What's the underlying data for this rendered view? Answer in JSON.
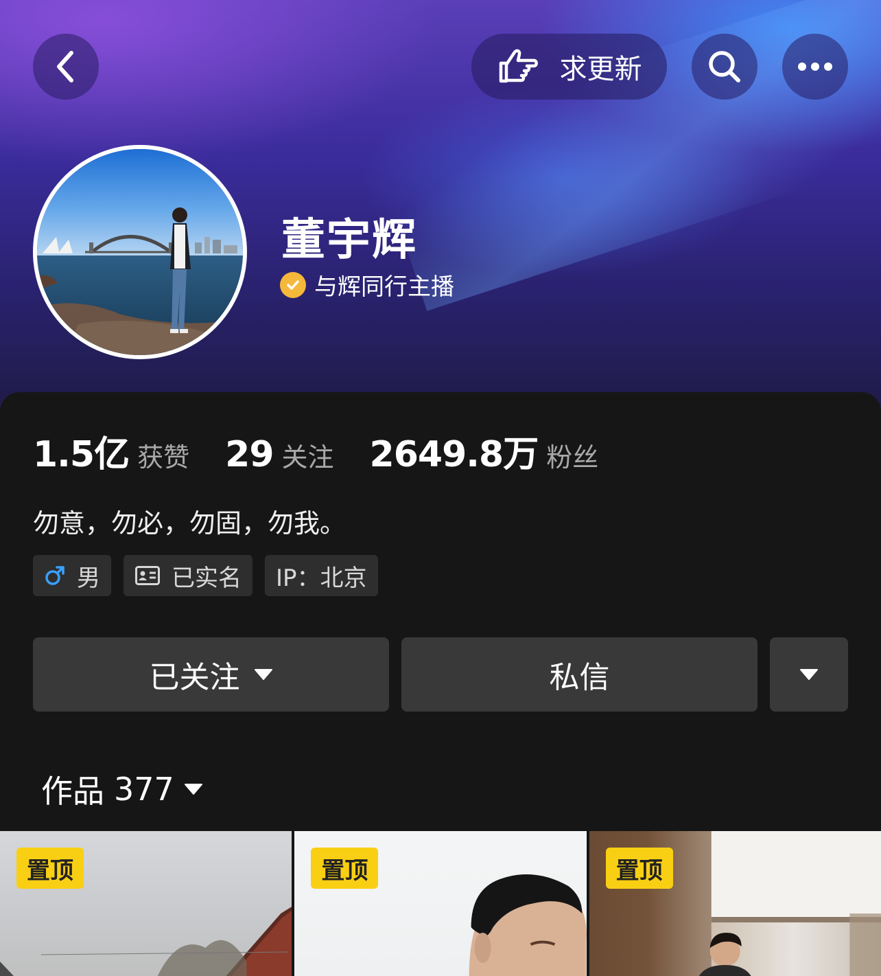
{
  "header": {
    "update_label": "求更新"
  },
  "profile": {
    "name": "董宇辉",
    "verified_label": "与辉同行主播"
  },
  "stats": {
    "likes_value": "1.5亿",
    "likes_label": "获赞",
    "following_value": "29",
    "following_label": "关注",
    "followers_value": "2649.8万",
    "followers_label": "粉丝"
  },
  "bio": "勿意，勿必，勿固，勿我。",
  "tags": {
    "gender": "男",
    "realname": "已实名",
    "ip": "IP：北京"
  },
  "actions": {
    "follow_label": "已关注",
    "message_label": "私信"
  },
  "works": {
    "label": "作品",
    "count": "377"
  },
  "grid": {
    "pin_label": "置顶"
  },
  "colors": {
    "verify_badge": "#f6b83a",
    "pin_badge": "#f9cf14",
    "gender_icon": "#3aa0ff",
    "background": "#161616",
    "button": "#393939"
  },
  "icons": [
    "back-arrow-icon",
    "pointing-hand-icon",
    "search-icon",
    "more-icon",
    "verified-check-icon",
    "male-icon",
    "id-card-icon",
    "caret-down-icon"
  ]
}
